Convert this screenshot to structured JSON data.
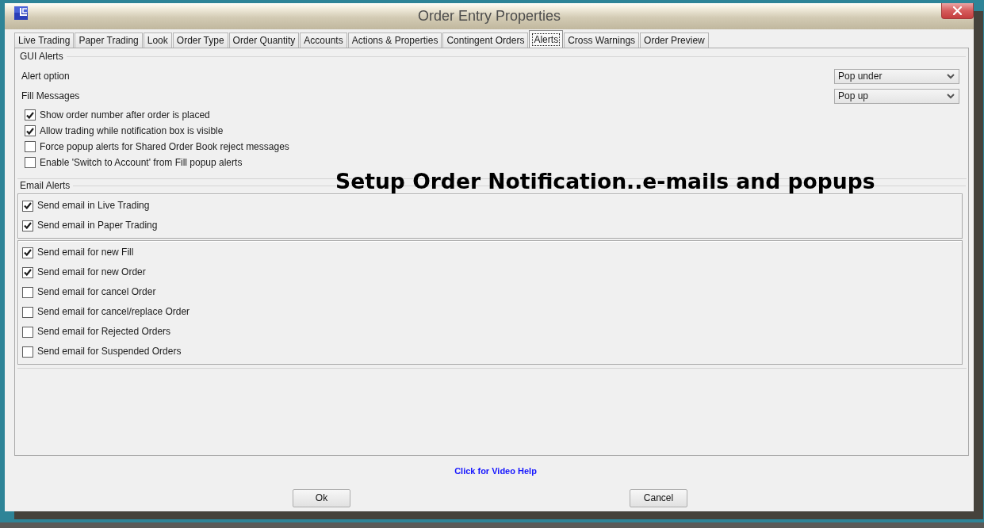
{
  "window": {
    "title": "Order Entry Properties"
  },
  "tabs": [
    {
      "label": "Live Trading",
      "selected": false
    },
    {
      "label": "Paper Trading",
      "selected": false
    },
    {
      "label": "Look",
      "selected": false
    },
    {
      "label": "Order Type",
      "selected": false
    },
    {
      "label": "Order Quantity",
      "selected": false
    },
    {
      "label": "Accounts",
      "selected": false
    },
    {
      "label": "Actions & Properties",
      "selected": false
    },
    {
      "label": "Contingent Orders",
      "selected": false
    },
    {
      "label": "Alerts",
      "selected": true
    },
    {
      "label": "Cross Warnings",
      "selected": false
    },
    {
      "label": "Order Preview",
      "selected": false
    }
  ],
  "gui_alerts": {
    "title": "GUI Alerts",
    "dropdowns": [
      {
        "label": "Alert option",
        "value": "Pop under"
      },
      {
        "label": "Fill Messages",
        "value": "Pop up"
      }
    ],
    "checkboxes": [
      {
        "label": "Show order number after order is placed",
        "checked": true
      },
      {
        "label": "Allow trading while notification box is visible",
        "checked": true
      },
      {
        "label": "Force popup alerts for Shared Order Book reject messages",
        "checked": false
      },
      {
        "label": "Enable 'Switch to Account' from Fill popup alerts",
        "checked": false
      }
    ]
  },
  "annotation": "Setup Order Notification..e-mails and popups",
  "email_alerts": {
    "title": "Email Alerts",
    "groups": [
      {
        "checkboxes": [
          {
            "label": "Send email in Live Trading",
            "checked": true
          },
          {
            "label": "Send email in Paper Trading",
            "checked": true
          }
        ]
      },
      {
        "checkboxes": [
          {
            "label": "Send email for new Fill",
            "checked": true
          },
          {
            "label": "Send email for new Order",
            "checked": true
          },
          {
            "label": "Send email for cancel Order",
            "checked": false
          },
          {
            "label": "Send email for cancel/replace Order",
            "checked": false
          },
          {
            "label": "Send email for Rejected Orders",
            "checked": false
          },
          {
            "label": "Send email for Suspended Orders",
            "checked": false
          }
        ]
      }
    ]
  },
  "help_link": "Click for Video Help",
  "buttons": [
    "Ok",
    "Cancel"
  ]
}
